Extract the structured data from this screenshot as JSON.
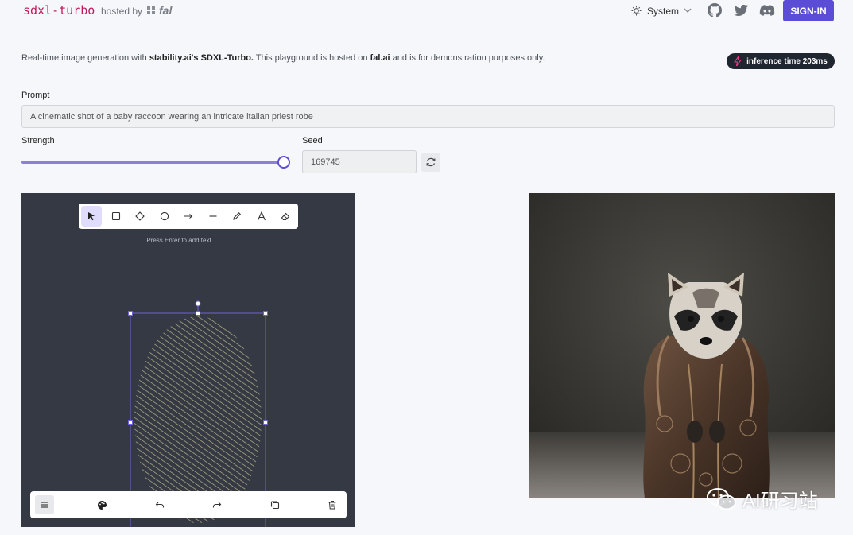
{
  "header": {
    "brand": "sdxl-turbo",
    "hosted_by": "hosted by",
    "host_name": "fal",
    "theme_label": "System",
    "sign_in": "SIGN-IN"
  },
  "description": {
    "prefix": "Real-time image generation with ",
    "model": "stability.ai's SDXL-Turbo.",
    "middle": " This playground is hosted on ",
    "host": "fal.ai",
    "suffix": " and is for demonstration purposes only."
  },
  "inference_badge": "inference time 203ms",
  "prompt": {
    "label": "Prompt",
    "value": "A cinematic shot of a baby raccoon wearing an intricate italian priest robe"
  },
  "strength": {
    "label": "Strength",
    "value_fraction": 1.0
  },
  "seed": {
    "label": "Seed",
    "value": "169745"
  },
  "canvas": {
    "hint": "Press Enter to add text",
    "tools": [
      "select-icon",
      "rectangle-icon",
      "diamond-icon",
      "ellipse-icon",
      "arrow-icon",
      "line-icon",
      "pencil-icon",
      "text-icon",
      "eraser-icon"
    ],
    "bottom_tools": [
      "menu-icon",
      "palette-icon",
      "undo-icon",
      "redo-icon",
      "duplicate-icon",
      "trash-icon"
    ],
    "shape_color": "#b9b58a",
    "selection_color": "#6f63d9"
  },
  "watermark": "AI研习站",
  "colors": {
    "accent": "#5b4dd6",
    "brand": "#c2185b",
    "badge_bg": "#1f2630"
  }
}
